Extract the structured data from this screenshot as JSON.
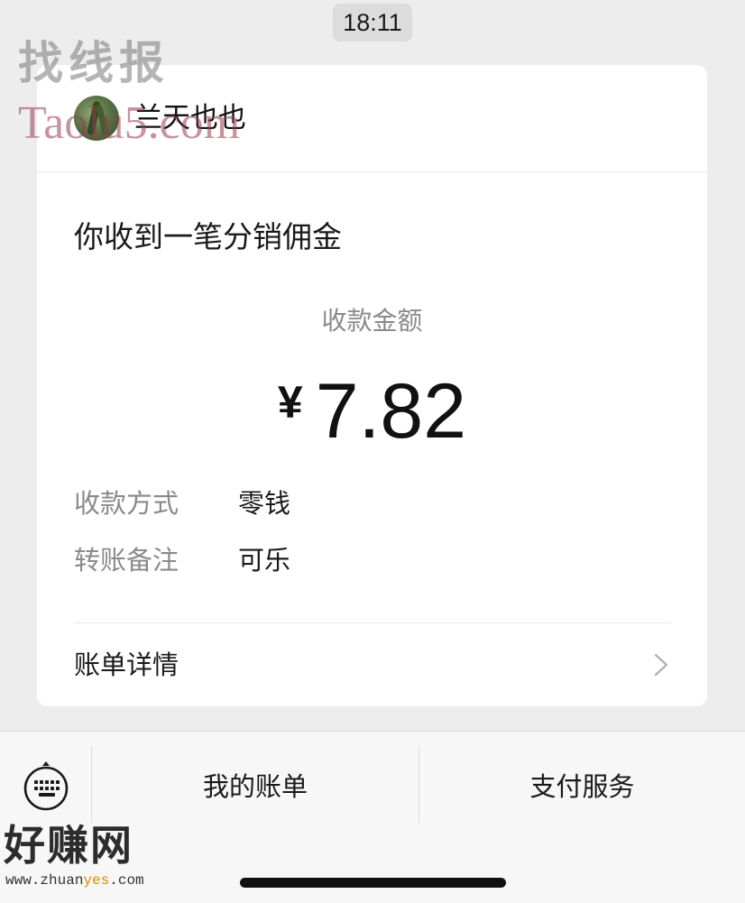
{
  "status": {
    "time": "18:11"
  },
  "card": {
    "sender_name": "兰天也也",
    "title": "你收到一笔分销佣金",
    "amount_label": "收款金额",
    "currency_symbol": "¥",
    "amount": "7.82",
    "rows": [
      {
        "label": "收款方式",
        "value": "零钱"
      },
      {
        "label": "转账备注",
        "value": "可乐"
      }
    ],
    "detail_label": "账单详情"
  },
  "bottom_menu": {
    "items": [
      {
        "label": "我的账单"
      },
      {
        "label": "支付服务"
      }
    ]
  },
  "watermarks": {
    "top_cn": "找线报",
    "top_en": "Taolu5.com",
    "bottom_cn": "好赚网",
    "bottom_url_pre": "www.zhuan",
    "bottom_url_hl": "yes",
    "bottom_url_post": ".com"
  },
  "icons": {
    "chevron": "chevron-right-icon",
    "keyboard": "keyboard-icon"
  }
}
